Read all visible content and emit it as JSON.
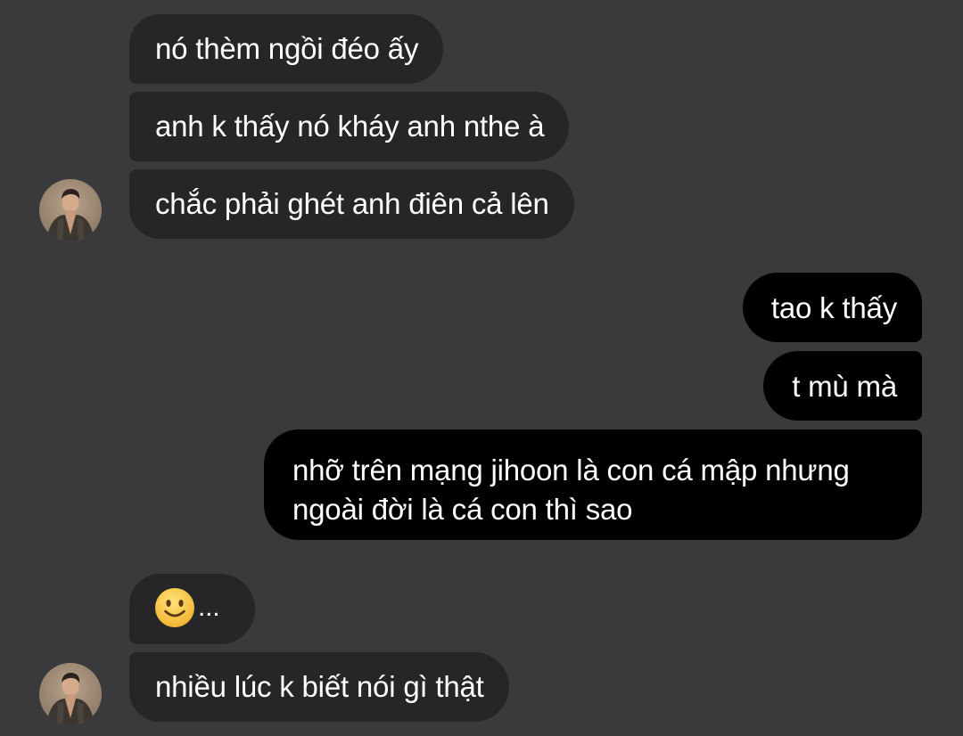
{
  "conversation": {
    "messages": [
      {
        "sender": "them",
        "text": "nó thèm ngồi đéo ấy"
      },
      {
        "sender": "them",
        "text": "anh k thấy nó kháy anh nthe à"
      },
      {
        "sender": "them",
        "text": "chắc phải ghét anh điên cả lên"
      },
      {
        "sender": "me",
        "text": "tao k thấy"
      },
      {
        "sender": "me",
        "text": "t mù mà"
      },
      {
        "sender": "me",
        "text": "nhỡ trên mạng jihoon là con cá mập nhưng ngoài đời là cá con thì sao"
      },
      {
        "sender": "them",
        "emoji": "slightly-smiling-face-icon",
        "text": "..."
      },
      {
        "sender": "them",
        "text": "nhiều lúc k biết nói gì thật"
      }
    ]
  },
  "colors": {
    "background": "#3a3a3c",
    "incoming_bubble": "#262528",
    "outgoing_bubble": "#000000",
    "text": "#ffffff",
    "emoji_face": "#f8c43a"
  },
  "icons": {
    "avatar": "contact-avatar-photo",
    "emoji": "slightly-smiling-face-icon"
  }
}
